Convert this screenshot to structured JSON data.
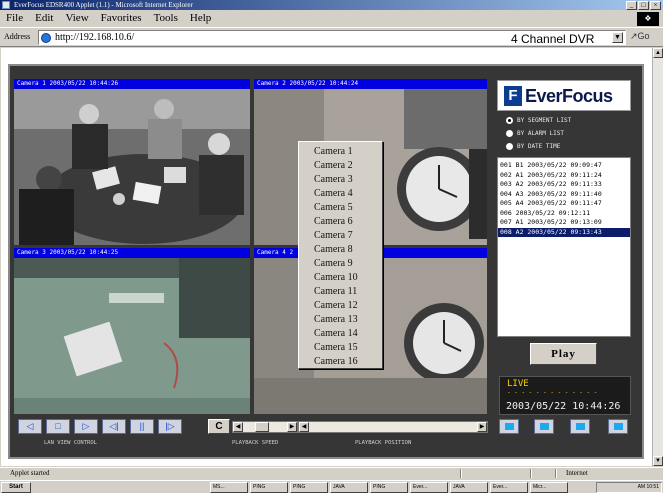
{
  "window": {
    "title": "EverFocus EDSR400 Applet (1.1) - Microsoft Internet Explorer",
    "buttons": {
      "minimize": "_",
      "maximize": "□",
      "close": "×"
    }
  },
  "menu": [
    "File",
    "Edit",
    "View",
    "Favorites",
    "Tools",
    "Help"
  ],
  "address": {
    "label": "Address",
    "url": "http://192.168.10.6/",
    "page_title": "4 Channel DVR",
    "go": "Go"
  },
  "cameras": [
    {
      "header": "Camera 1 2003/05/22 10:44:26"
    },
    {
      "header": "Camera 2 2003/05/22 10:44:24"
    },
    {
      "header": "Camera 3 2003/05/22 10:44:25"
    },
    {
      "header": "Camera 4 2"
    }
  ],
  "camera_menu": [
    "Camera 1",
    "Camera 2",
    "Camera 3",
    "Camera 4",
    "Camera 5",
    "Camera 6",
    "Camera 7",
    "Camera 8",
    "Camera 9",
    "Camera 10",
    "Camera 11",
    "Camera 12",
    "Camera 13",
    "Camera 14",
    "Camera 15",
    "Camera 16"
  ],
  "brand": {
    "letter": "F",
    "name": "EverFocus"
  },
  "search_modes": [
    {
      "label": "BY SEGMENT LIST",
      "selected": true
    },
    {
      "label": "BY ALARM LIST",
      "selected": false
    },
    {
      "label": "BY DATE TIME",
      "selected": false
    }
  ],
  "event_list": [
    {
      "text": "001 B1 2003/05/22 09:09:47",
      "selected": false
    },
    {
      "text": "002 A1 2003/05/22 09:11:24",
      "selected": false
    },
    {
      "text": "003 A2 2003/05/22 09:11:33",
      "selected": false
    },
    {
      "text": "004 A3 2003/05/22 09:11:40",
      "selected": false
    },
    {
      "text": "005 A4 2003/05/22 09:11:47",
      "selected": false
    },
    {
      "text": "006    2003/05/22 09:12:11",
      "selected": false
    },
    {
      "text": "007 A1 2003/05/22 09:13:09",
      "selected": false
    },
    {
      "text": "008 A2 2003/05/22 09:13:43",
      "selected": true
    }
  ],
  "play_label": "Play",
  "status": {
    "mode": "LIVE",
    "dashes": "- - - - - - - - - - - - -",
    "datetime": "2003/05/22 10:44:26"
  },
  "controls": {
    "buttons": [
      "◁",
      "□",
      "▷",
      "◁|",
      "||",
      "|▷"
    ],
    "c_button": "C",
    "labels": {
      "view_control": "LAN VIEW CONTROL",
      "speed": "PLAYBACK SPEED",
      "position": "PLAYBACK POSITION"
    }
  },
  "statusbar": {
    "message": "Applet started",
    "zone": "Internet"
  },
  "taskbar": {
    "start": "Start",
    "tasks": [
      "MS...",
      "PING",
      "PING",
      "JAVA",
      "PING",
      "Ever...",
      "JAVA",
      "Ever...",
      "Micr..."
    ],
    "clock": "AM 10:51"
  }
}
